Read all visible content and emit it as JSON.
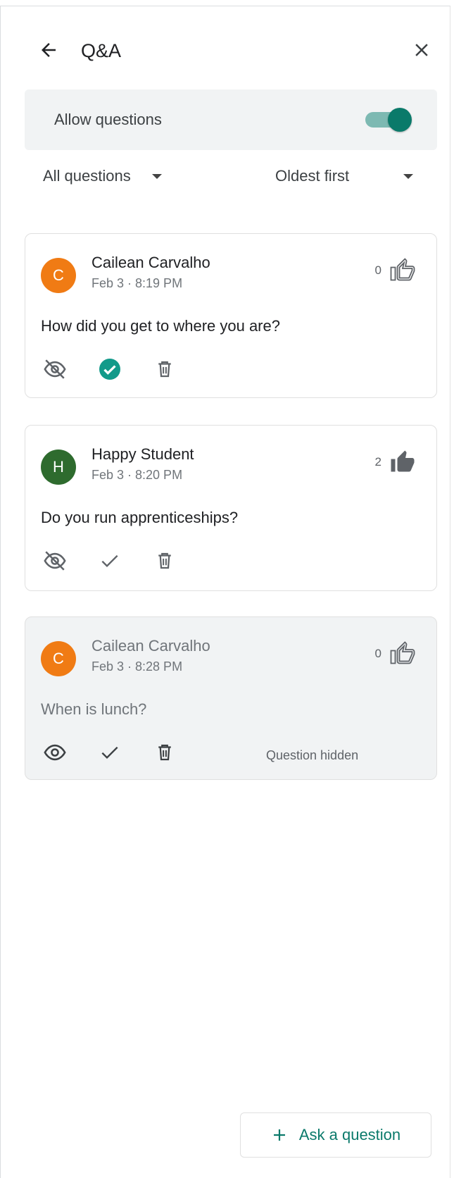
{
  "header": {
    "title": "Q&A",
    "back_icon": "arrow-back-icon",
    "close_icon": "close-icon"
  },
  "allow_questions": {
    "label": "Allow questions",
    "enabled": true,
    "accent": "#0a7a6a"
  },
  "filters": {
    "questions": "All questions",
    "sort": "Oldest first"
  },
  "questions": [
    {
      "author": "Cailean Carvalho",
      "initial": "C",
      "avatar_color": "#f07b14",
      "time": "Feb 3 · 8:19 PM",
      "votes": "0",
      "voted": false,
      "text": "How did you get to where you are?",
      "answered": true,
      "hidden": false,
      "status": ""
    },
    {
      "author": "Happy Student",
      "initial": "H",
      "avatar_color": "#2e6b2e",
      "time": "Feb 3 · 8:20 PM",
      "votes": "2",
      "voted": true,
      "text": "Do you run apprenticeships?",
      "answered": false,
      "hidden": false,
      "status": ""
    },
    {
      "author": "Cailean Carvalho",
      "initial": "C",
      "avatar_color": "#f07b14",
      "time": "Feb 3 · 8:28 PM",
      "votes": "0",
      "voted": false,
      "text": "When is lunch?",
      "answered": false,
      "hidden": true,
      "status": "Question hidden"
    }
  ],
  "ask_button": {
    "label": "Ask a question",
    "icon": "plus-icon"
  }
}
